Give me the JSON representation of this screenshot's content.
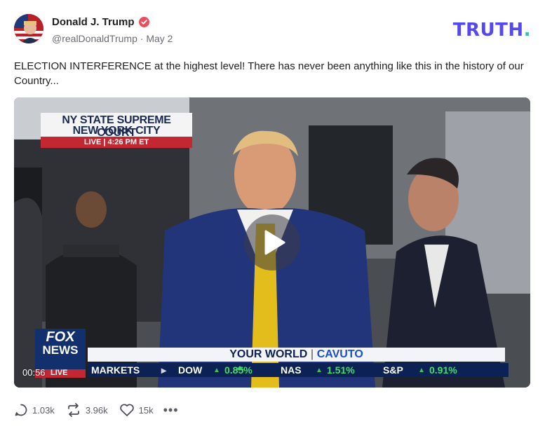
{
  "author": {
    "name": "Donald J. Trump",
    "handle": "@realDonaldTrump",
    "separator": "·",
    "date": "May 2"
  },
  "brand": {
    "name": "TRUTH",
    "dot": "."
  },
  "post": {
    "text": "ELECTION INTERFERENCE at the highest level! There has never been anything like this in the history of our Country..."
  },
  "video": {
    "timestamp": "00:56",
    "chyron": {
      "line1": "NY STATE SUPREME COURT",
      "line2": "NEW YORK CITY",
      "live_label": "LIVE",
      "time": "4:26 PM ET"
    },
    "network_logo_top": "FOX",
    "network_logo_bottom": "NEWS",
    "network_live": "LIVE",
    "show_title_left": "YOUR WORLD",
    "show_title_right": "CAVUTO",
    "ticker": {
      "markets": "MARKETS",
      "items": [
        {
          "name": "DOW",
          "change": "0.85%"
        },
        {
          "name": "NAS",
          "change": "1.51%"
        },
        {
          "name": "S&P",
          "change": "0.91%"
        }
      ]
    }
  },
  "actions": {
    "replies": "1.03k",
    "retruths": "3.96k",
    "likes": "15k",
    "more": "•••"
  },
  "colors": {
    "brand_purple": "#5448ee",
    "brand_teal": "#2bc4a9",
    "verified": "#e8505b"
  }
}
